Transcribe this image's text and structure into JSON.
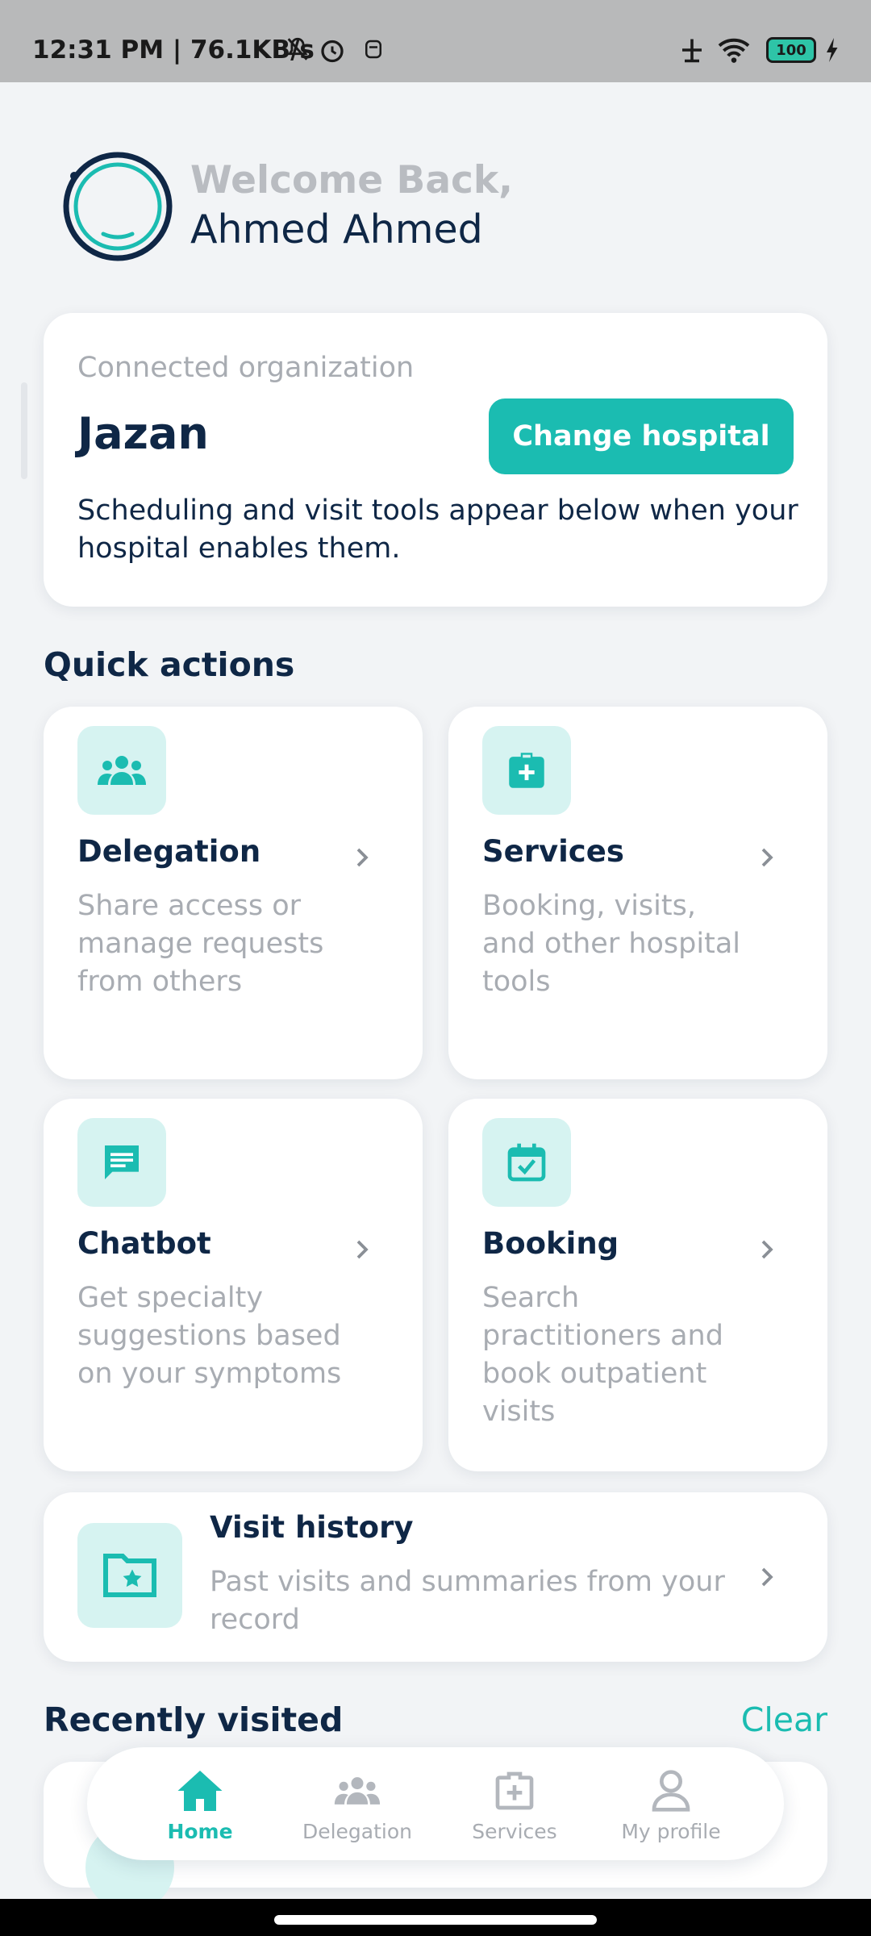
{
  "status_bar": {
    "text": "12:31 PM | 76.1KB/s",
    "battery": "100",
    "icons": [
      "mute-icon",
      "alarm-icon",
      "notification-icon",
      "signal-icon",
      "wifi-icon",
      "battery-icon",
      "charging-icon"
    ]
  },
  "header": {
    "welcome": "Welcome Back,",
    "name": "Ahmed Ahmed"
  },
  "organization": {
    "label": "Connected organization",
    "name": "Jazan",
    "change_button": "Change hospital",
    "description": "Scheduling and visit tools appear below when your hospital enables them."
  },
  "quick_actions": {
    "title": "Quick actions",
    "tiles": [
      {
        "title": "Delegation",
        "description": "Share access or manage requests from others",
        "icon": "people-icon"
      },
      {
        "title": "Services",
        "description": "Booking, visits, and other hospital tools",
        "icon": "medical-bag-icon"
      },
      {
        "title": "Chatbot",
        "description": "Get specialty suggestions based on your symptoms",
        "icon": "chat-icon"
      },
      {
        "title": "Booking",
        "description": "Search practitioners and book outpatient visits",
        "icon": "calendar-check-icon"
      }
    ],
    "visit_history": {
      "title": "Visit history",
      "description": "Past visits and summaries from your record",
      "icon": "folder-star-icon"
    }
  },
  "recently_visited": {
    "title": "Recently visited",
    "clear_label": "Clear"
  },
  "bottom_nav": {
    "items": [
      {
        "label": "Home",
        "icon": "home-icon",
        "active": true
      },
      {
        "label": "Delegation",
        "icon": "people-icon",
        "active": false
      },
      {
        "label": "Services",
        "icon": "medical-bag-icon",
        "active": false
      },
      {
        "label": "My profile",
        "icon": "person-icon",
        "active": false
      }
    ]
  },
  "colors": {
    "accent": "#1bbcb1",
    "navy": "#0f2746",
    "muted": "#a8acb2",
    "icon_bg": "#d6f3f1",
    "background": "#f2f4f6"
  }
}
